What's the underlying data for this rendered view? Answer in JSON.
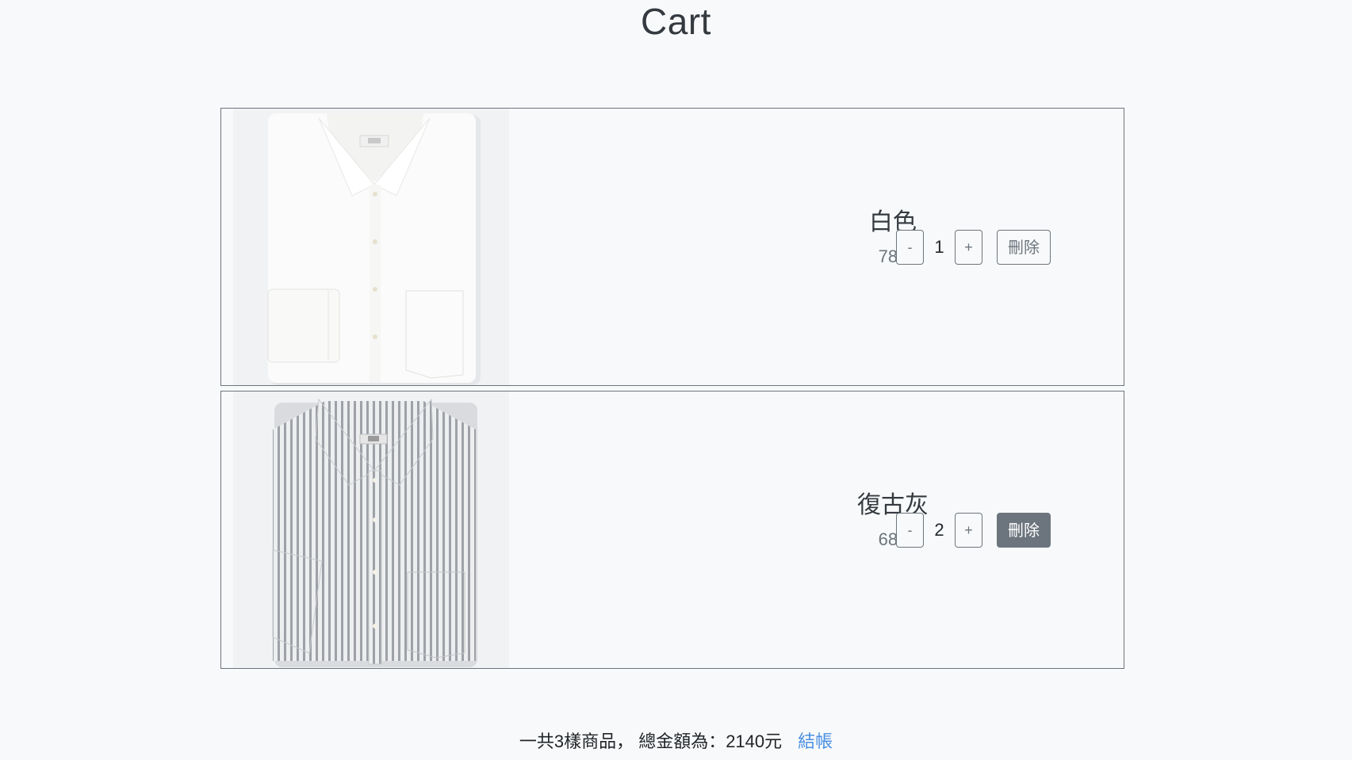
{
  "page": {
    "title": "Cart"
  },
  "items": [
    {
      "name": "白色",
      "price": "780",
      "quantity": "1",
      "minus_label": "-",
      "plus_label": "+",
      "delete_label": "刪除"
    },
    {
      "name": "復古灰",
      "price": "680",
      "quantity": "2",
      "minus_label": "-",
      "plus_label": "+",
      "delete_label": "刪除"
    }
  ],
  "summary": {
    "text": "一共3樣商品， 總金額為：2140元",
    "checkout_label": "結帳"
  },
  "colors": {
    "background": "#f8f9fa",
    "border": "#6c757d",
    "link": "#4a90e2"
  }
}
